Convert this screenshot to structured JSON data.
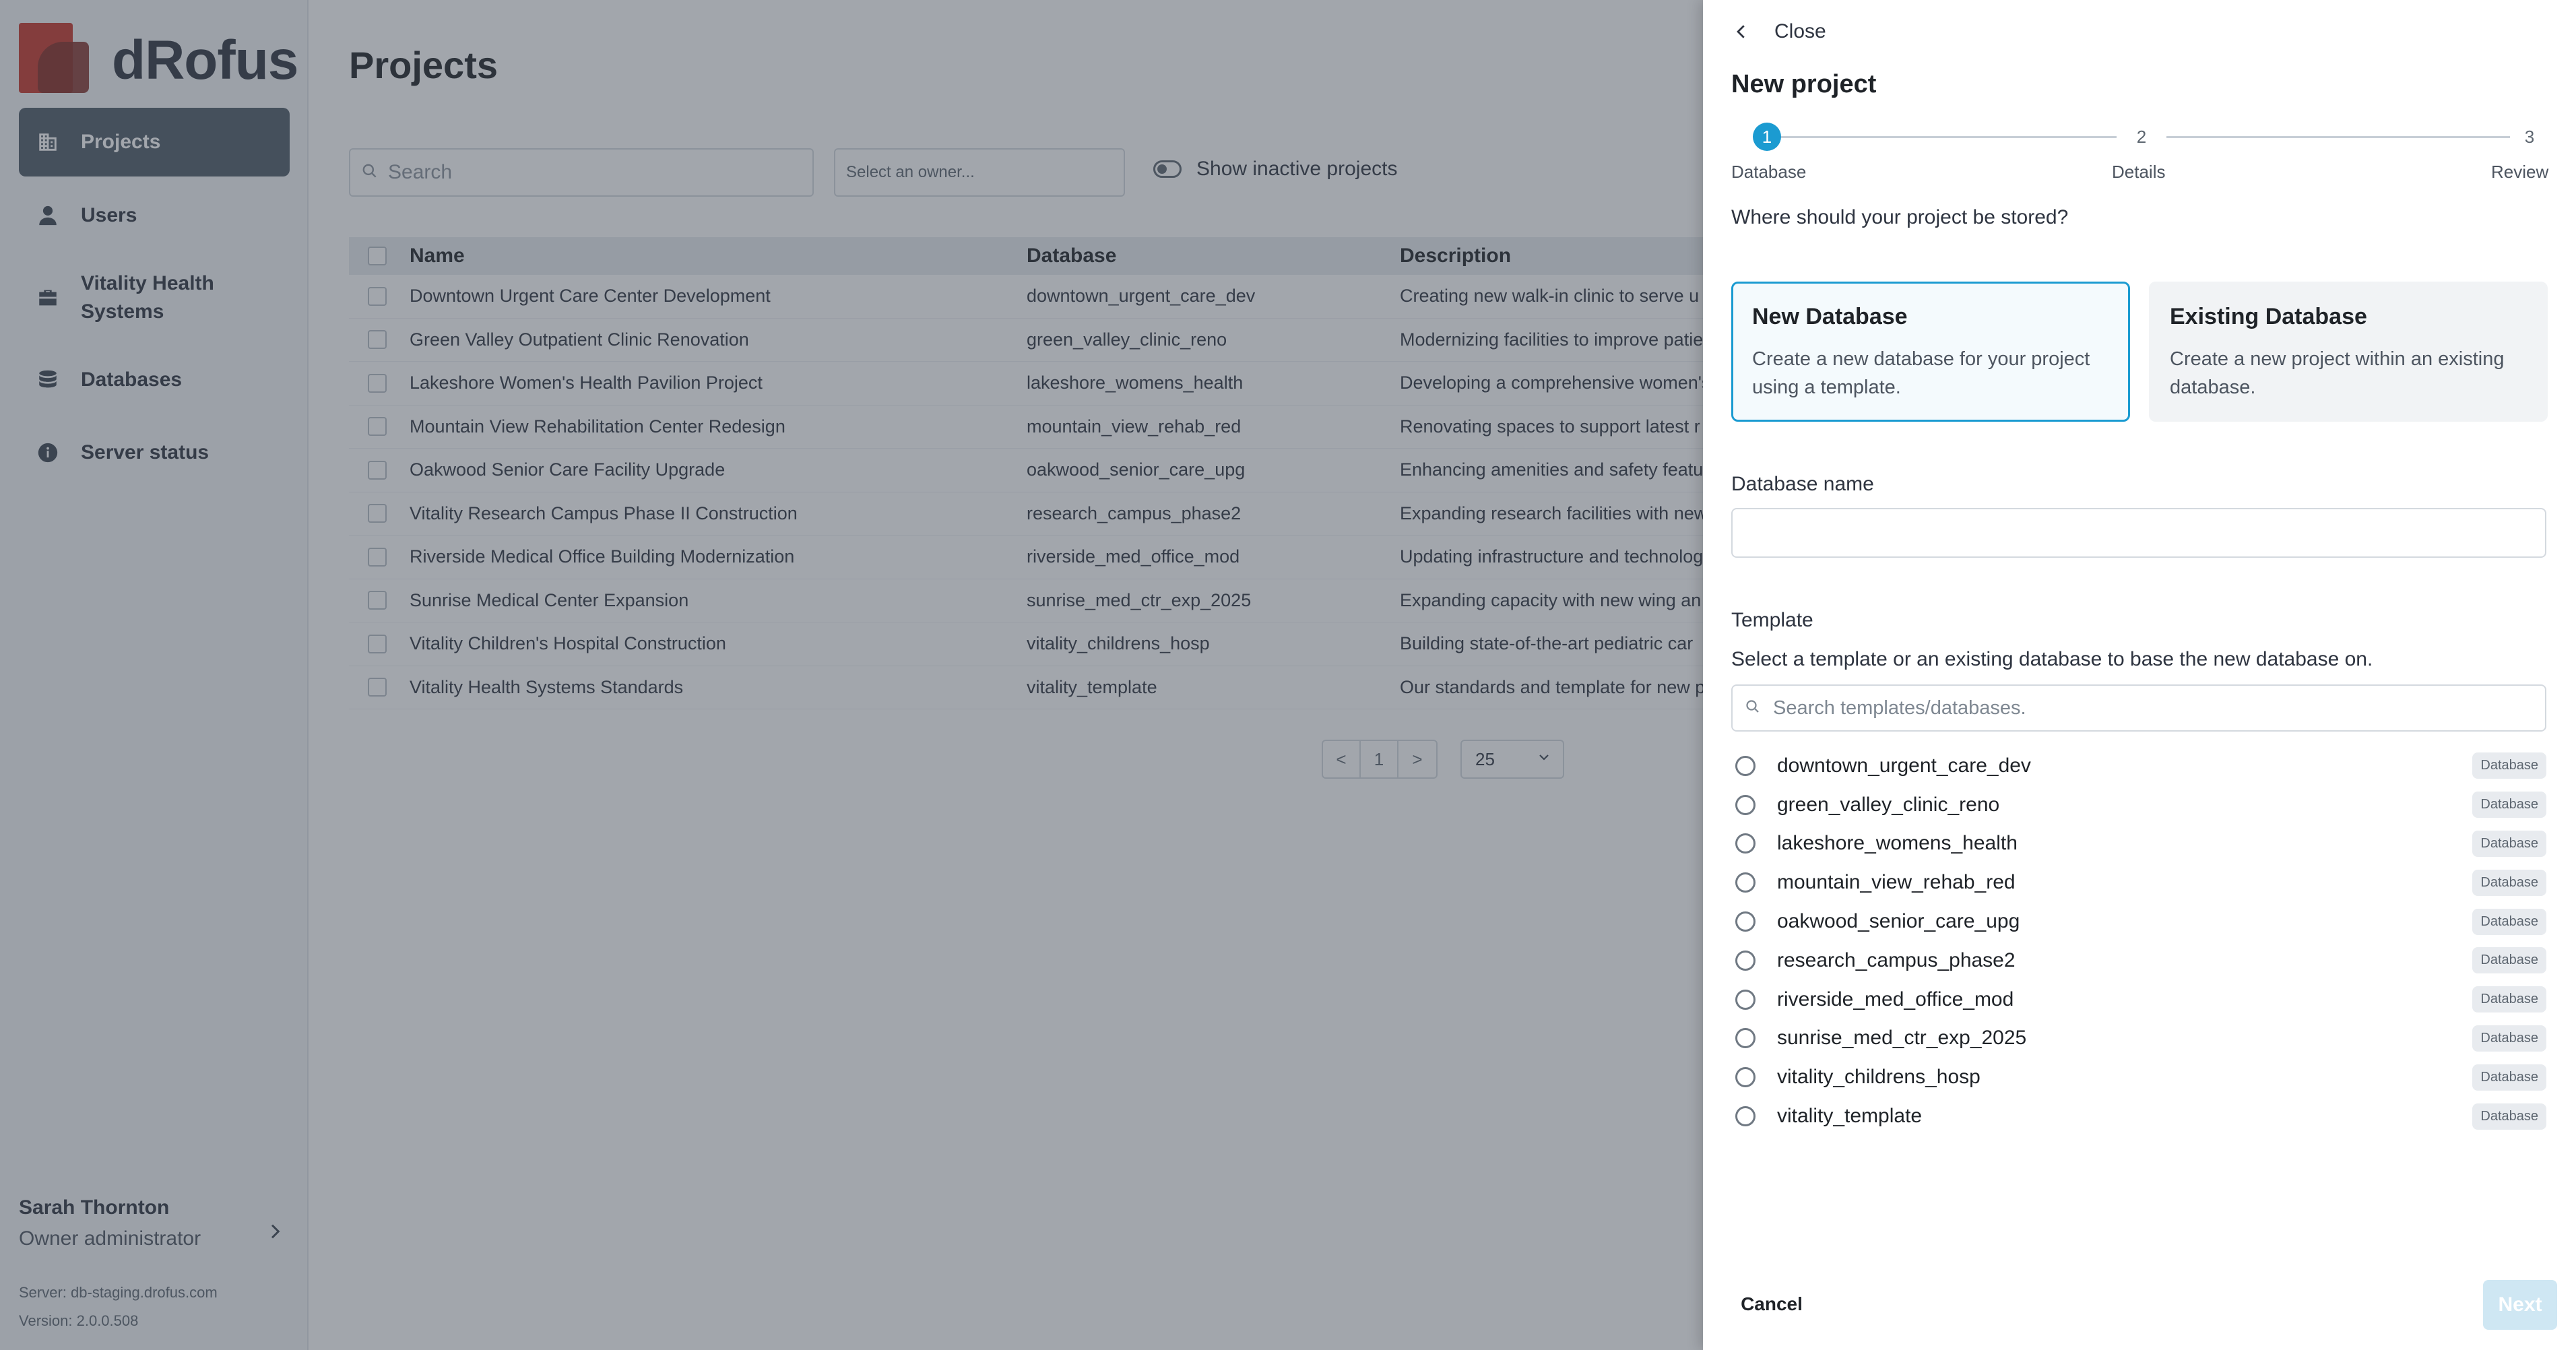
{
  "logo": {
    "text": "dRofus"
  },
  "nav": [
    {
      "label": "Projects",
      "icon": "building-icon",
      "active": true
    },
    {
      "label": "Users",
      "icon": "user-icon",
      "active": false
    },
    {
      "label": "Vitality Health Systems",
      "icon": "briefcase-icon",
      "active": false
    },
    {
      "label": "Databases",
      "icon": "database-icon",
      "active": false
    },
    {
      "label": "Server status",
      "icon": "info-icon",
      "active": false
    }
  ],
  "user": {
    "name": "Sarah Thornton",
    "role": "Owner administrator",
    "server": "Server: db-staging.drofus.com",
    "version": "Version: 2.0.0.508"
  },
  "main": {
    "title": "Projects",
    "search_placeholder": "Search",
    "owner_placeholder": "Select an owner...",
    "inactive_toggle_label": "Show inactive projects",
    "columns": {
      "name": "Name",
      "database": "Database",
      "description": "Description"
    },
    "rows": [
      {
        "name": "Downtown Urgent Care Center Development",
        "database": "downtown_urgent_care_dev",
        "description": "Creating new walk-in clinic to serve u"
      },
      {
        "name": "Green Valley Outpatient Clinic Renovation",
        "database": "green_valley_clinic_reno",
        "description": "Modernizing facilities to improve patie"
      },
      {
        "name": "Lakeshore Women's Health Pavilion Project",
        "database": "lakeshore_womens_health",
        "description": "Developing a comprehensive women's"
      },
      {
        "name": "Mountain View Rehabilitation Center Redesign",
        "database": "mountain_view_rehab_red",
        "description": "Renovating spaces to support latest r"
      },
      {
        "name": "Oakwood Senior Care Facility Upgrade",
        "database": "oakwood_senior_care_upg",
        "description": "Enhancing amenities and safety featu"
      },
      {
        "name": "Vitality Research Campus Phase II Construction",
        "database": "research_campus_phase2",
        "description": "Expanding research facilities with new"
      },
      {
        "name": "Riverside Medical Office Building Modernization",
        "database": "riverside_med_office_mod",
        "description": "Updating infrastructure and technolog"
      },
      {
        "name": "Sunrise Medical Center Expansion",
        "database": "sunrise_med_ctr_exp_2025",
        "description": "Expanding capacity with new wing an"
      },
      {
        "name": "Vitality Children's Hospital Construction",
        "database": "vitality_childrens_hosp",
        "description": "Building state-of-the-art pediatric car"
      },
      {
        "name": "Vitality Health Systems Standards",
        "database": "vitality_template",
        "description": "Our standards and template for new p"
      }
    ],
    "pager": {
      "prev": "<",
      "page": "1",
      "next": ">"
    },
    "page_size": "25"
  },
  "drawer": {
    "close_label": "Close",
    "title": "New project",
    "steps": [
      {
        "number": "1",
        "label": "Database",
        "state": "active"
      },
      {
        "number": "2",
        "label": "Details",
        "state": "pending"
      },
      {
        "number": "3",
        "label": "Review",
        "state": "pending"
      }
    ],
    "question": "Where should your project be stored?",
    "options": {
      "new": {
        "title": "New Database",
        "description": "Create a new database for your project using a template."
      },
      "existing": {
        "title": "Existing Database",
        "description": "Create a new project within an existing database."
      }
    },
    "db_name_label": "Database name",
    "db_name_value": "",
    "template_label": "Template",
    "template_help": "Select a template or an existing database to base the new database on.",
    "template_search_placeholder": "Search templates/databases.",
    "templates": [
      {
        "name": "downtown_urgent_care_dev",
        "badge": "Database"
      },
      {
        "name": "green_valley_clinic_reno",
        "badge": "Database"
      },
      {
        "name": "lakeshore_womens_health",
        "badge": "Database"
      },
      {
        "name": "mountain_view_rehab_red",
        "badge": "Database"
      },
      {
        "name": "oakwood_senior_care_upg",
        "badge": "Database"
      },
      {
        "name": "research_campus_phase2",
        "badge": "Database"
      },
      {
        "name": "riverside_med_office_mod",
        "badge": "Database"
      },
      {
        "name": "sunrise_med_ctr_exp_2025",
        "badge": "Database"
      },
      {
        "name": "vitality_childrens_hosp",
        "badge": "Database"
      },
      {
        "name": "vitality_template",
        "badge": "Database"
      }
    ],
    "cancel_label": "Cancel",
    "next_label": "Next"
  },
  "colors": {
    "accent": "#1b9bd1",
    "brand_red": "#c6362b",
    "nav_active": "#4e5a67",
    "overlay": "rgba(60,70,82,0.48)"
  }
}
